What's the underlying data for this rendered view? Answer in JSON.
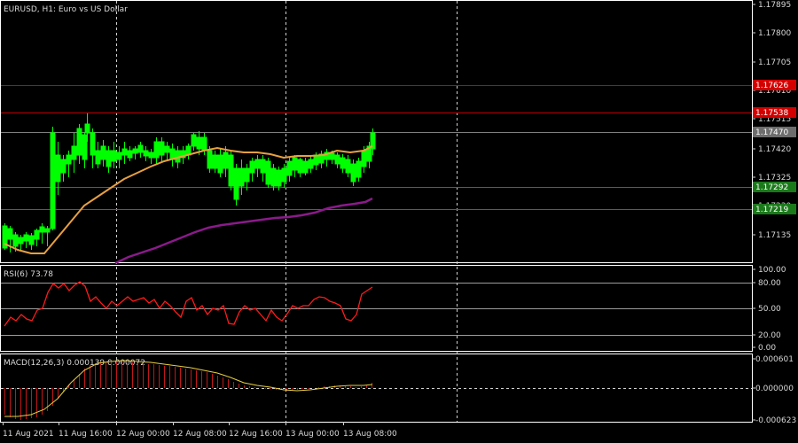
{
  "main_title": "EURUSD, H1:  Euro vs US Dollar",
  "rsi_title": "RSI(6) 73.78",
  "macd_title": "MACD(12,26,3) 0.000139 0.000072",
  "price_axis_ticks": [
    "1.17895",
    "1.17800",
    "1.17705",
    "1.17610",
    "1.17515",
    "1.17420",
    "1.17325",
    "1.17230",
    "1.17135"
  ],
  "price_level_tags": [
    {
      "text": "1.17626",
      "bg": "#d40000",
      "fg": "#ffffff"
    },
    {
      "text": "1.17538",
      "bg": "#d40000",
      "fg": "#ffffff"
    },
    {
      "text": "1.17470",
      "bg": "#6d6d6d",
      "fg": "#ffffff"
    },
    {
      "text": "1.17292",
      "bg": "#1a7a1a",
      "fg": "#ffffff"
    },
    {
      "text": "1.17219",
      "bg": "#1a7a1a",
      "fg": "#ffffff"
    }
  ],
  "rsi_axis_ticks": [
    "100.00",
    "80.00",
    "50.00",
    "20.00",
    "0.00"
  ],
  "macd_axis_ticks": [
    "0.000601",
    "0.000000",
    "-0.000623"
  ],
  "x_axis_labels": [
    "11 Aug 2021",
    "11 Aug 16:00",
    "12 Aug 00:00",
    "12 Aug 08:00",
    "12 Aug 16:00",
    "13 Aug 00:00",
    "13 Aug 08:00"
  ],
  "colors": {
    "background": "#000000",
    "bull_candle": "#ffffff",
    "bear_candle": "#00ff00",
    "ma_fast": "#e8a040",
    "ma_slow": "#8b1a8b",
    "resistance": "#cc0000",
    "support": "#1a8a1a",
    "current": "#808080",
    "rsi_line": "#ff1a1a",
    "macd_hist": "#c01818",
    "macd_signal": "#e8d040",
    "grid": "#d0d0d0"
  }
}
